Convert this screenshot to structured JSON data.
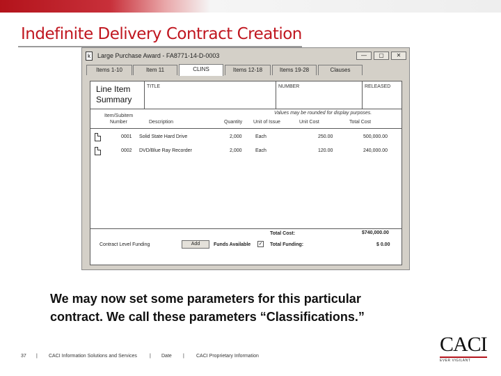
{
  "slide": {
    "title": "Indefinite Delivery Contract Creation",
    "caption_line1": "We may now set some parameters for this particular",
    "caption_line2": "contract.  We call these parameters “Classifications.”"
  },
  "window": {
    "title": "Large Purchase Award - FA8771-14-D-0003",
    "minimize": "—",
    "restore": "▢",
    "close": "✕"
  },
  "tabs": [
    {
      "label": "Items 1-10",
      "active": false
    },
    {
      "label": "Item 11",
      "active": false
    },
    {
      "label": "CLINS",
      "active": true
    },
    {
      "label": "Items 12-18",
      "active": false
    },
    {
      "label": "Items 19-28",
      "active": false
    },
    {
      "label": "Clauses",
      "active": false
    }
  ],
  "summary": {
    "title_line1": "Line Item",
    "title_line2": "Summary",
    "title_label": "TITLE",
    "number_label": "NUMBER",
    "released_label": "RELEASED",
    "rounding_note": "Values may be rounded for display purposes.",
    "columns": {
      "item_line1": "Item/Subitem",
      "item_line2": "Number",
      "description": "Description",
      "quantity": "Quantity",
      "unit_of_issue": "Unit of Issue",
      "unit_cost": "Unit Cost",
      "total_cost": "Total Cost"
    },
    "rows": [
      {
        "number": "0001",
        "description": "Solid State Hard Drive",
        "quantity": "2,000",
        "unit": "Each",
        "unit_cost": "250.00",
        "total_cost": "500,000.00"
      },
      {
        "number": "0002",
        "description": "DVD/Blue Ray Recorder",
        "quantity": "2,000",
        "unit": "Each",
        "unit_cost": "120.00",
        "total_cost": "240,000.00"
      }
    ],
    "total_cost_label": "Total Cost:",
    "total_cost_value": "$740,000.00",
    "funding_label": "Contract Level Funding",
    "add_button": "Add",
    "funds_available_label": "Funds Available",
    "funds_available_checked": true,
    "total_funding_label": "Total Funding:",
    "total_funding_value": "$ 0.00"
  },
  "footer": {
    "page_number": "37",
    "sep": "|",
    "company": "CACI Information Solutions and Services",
    "date": "Date",
    "proprietary": "CACI Proprietary Information"
  },
  "logo": {
    "text": "CACI",
    "tagline": "EVER VIGILANT"
  },
  "colors": {
    "accent_red": "#c0161f",
    "window_gray": "#d4d0c8"
  }
}
